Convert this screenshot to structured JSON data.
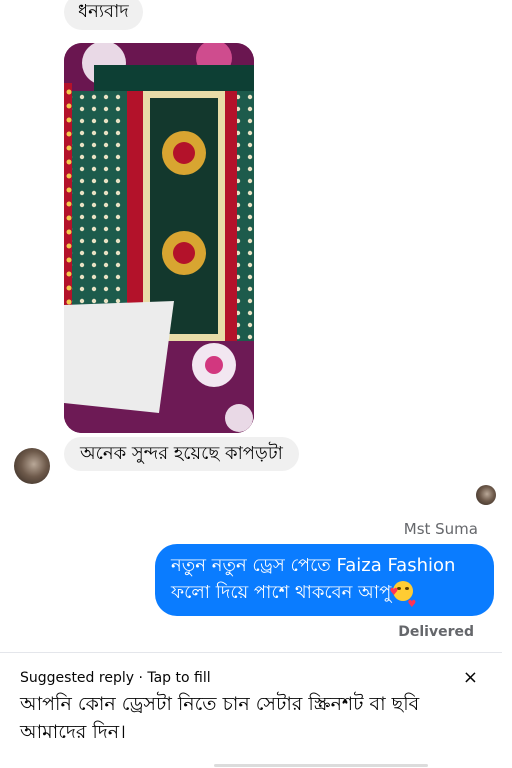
{
  "messages": {
    "incoming_thanks": "ধন্যবাদ",
    "incoming_compliment": "অনেক সুন্দর হয়েছে কাপড়টা"
  },
  "outgoing": {
    "sender_name": "Mst Suma",
    "text_line1": "নতুন নতুন ড্রেস পেতে Faiza Fashion",
    "text_line2": "ফলো দিয়ে পাশে থাকবেন আপু",
    "emoji": "smiling-face-with-hearts",
    "status": "Delivered"
  },
  "suggestion": {
    "header": "Suggested reply · Tap to fill",
    "text": "আপনি কোন ড্রেসটা নিতে চান সেটার স্ক্রিনশট বা ছবি আমাদের দিন।",
    "close_icon": "×"
  },
  "colors": {
    "outgoing_bubble": "#0a7cff",
    "incoming_bubble": "#f0f0f0",
    "meta_text": "#65676b"
  }
}
